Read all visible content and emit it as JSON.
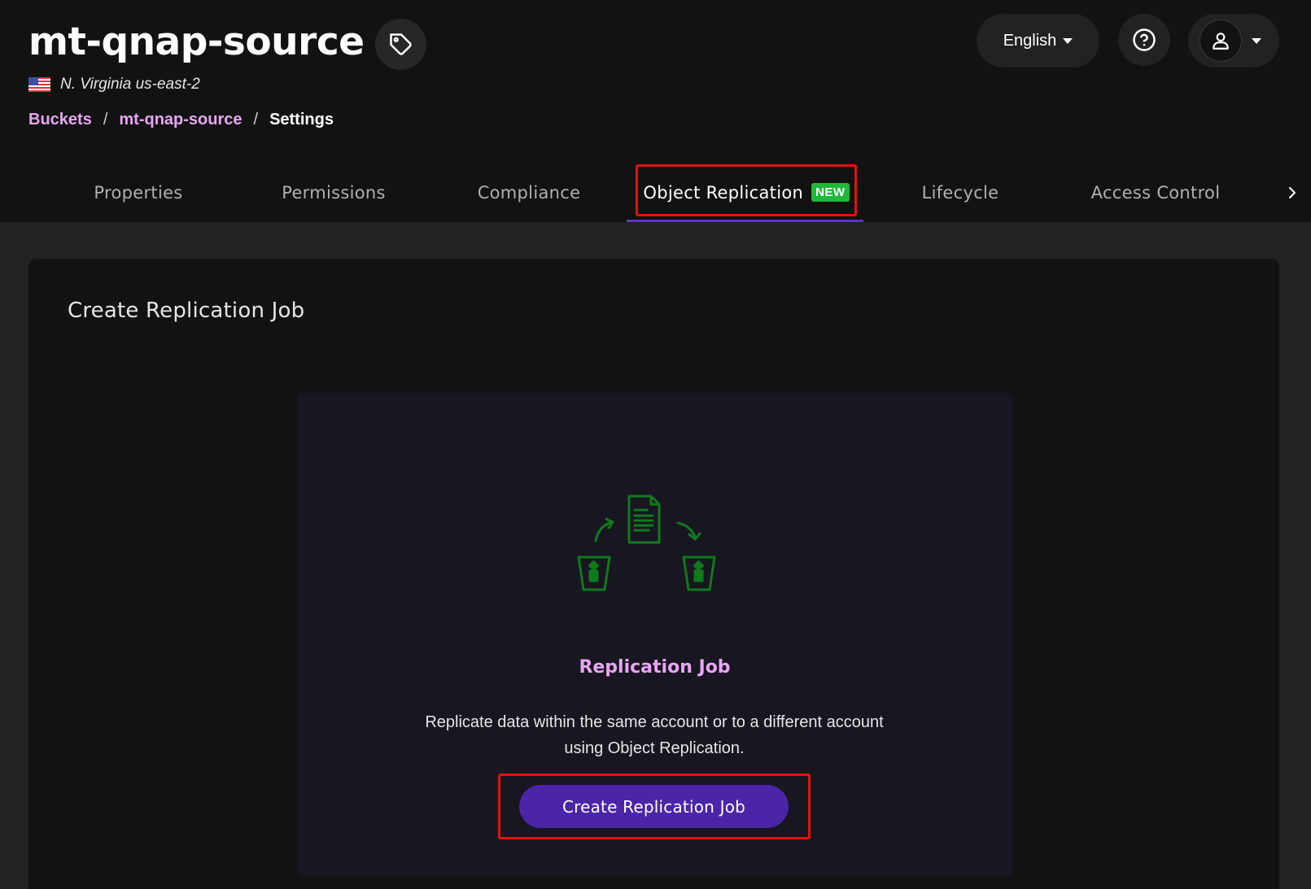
{
  "header": {
    "bucket_name": "mt-qnap-source",
    "region": "N. Virginia us-east-2",
    "flag_icon": "us-flag-icon",
    "tag_icon": "tag-icon"
  },
  "breadcrumb": {
    "items": [
      "Buckets",
      "mt-qnap-source",
      "Settings"
    ],
    "separator": "/"
  },
  "topbar_actions": {
    "language": "English",
    "help_icon": "question-circle-icon",
    "user_icon": "user-icon"
  },
  "tabs": {
    "items": [
      {
        "label": "Properties"
      },
      {
        "label": "Permissions"
      },
      {
        "label": "Compliance"
      },
      {
        "label": "Object Replication",
        "badge": "NEW",
        "active": true
      },
      {
        "label": "Lifecycle"
      },
      {
        "label": "Access Control"
      }
    ],
    "next_icon": "chevron-right-icon"
  },
  "main": {
    "section_title": "Create Replication Job",
    "empty_state": {
      "title": "Replication Job",
      "description": "Replicate data within the same account or to a different account using Object Replication.",
      "button_label": "Create Replication Job",
      "illustration_icon": "replication-illustration-icon"
    }
  },
  "colors": {
    "accent": "#e7a6f2",
    "primary_button": "#4a25a8",
    "badge_green": "#1fb83a",
    "highlight_red": "#e3120b",
    "illustration_green": "#0f7a1c"
  }
}
